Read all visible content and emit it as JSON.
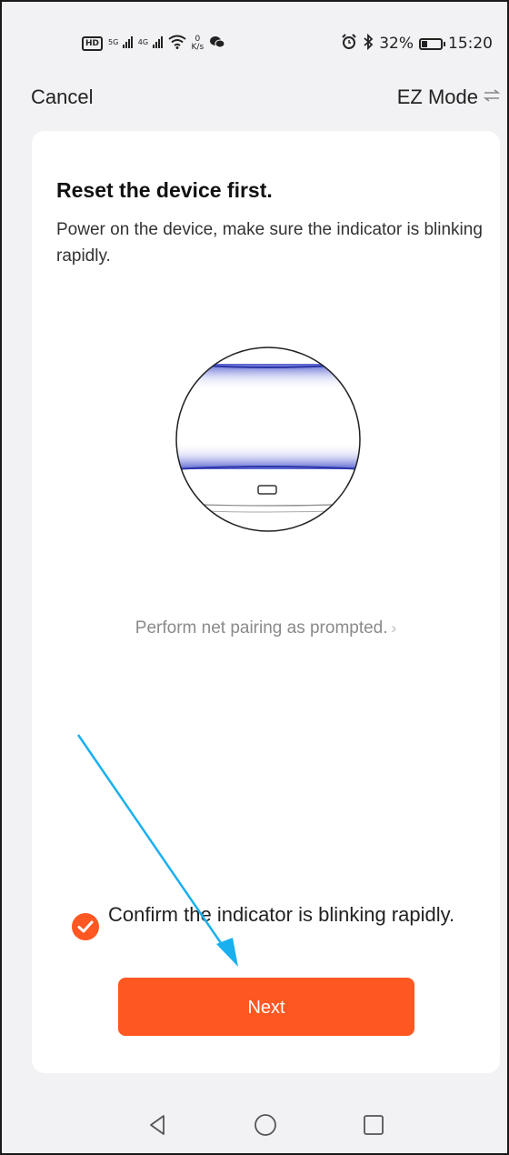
{
  "status_bar": {
    "left_icons": [
      "hd-icon",
      "signal-5g-icon",
      "signal-4g-icon",
      "wifi-icon",
      "netspeed-icon",
      "wechat-icon"
    ],
    "netspeed_value": "0",
    "netspeed_unit": "K/s",
    "signal_labels": [
      "5G",
      "4G"
    ],
    "hd_label": "HD",
    "battery_percent": "32%",
    "battery_level": 0.32,
    "time": "15:20",
    "right_icons": [
      "alarm-icon",
      "bluetooth-icon",
      "battery-icon"
    ]
  },
  "header": {
    "cancel_label": "Cancel",
    "mode_label": "EZ Mode",
    "mode_icon": "swap-icon"
  },
  "card": {
    "title": "Reset the device first.",
    "description": "Power on the device, make sure the indicator is blinking rapidly.",
    "illustration": "device-indicator-illustration",
    "pairing_link": "Perform net pairing as prompted.",
    "pairing_chevron": "›",
    "confirm_checked": true,
    "confirm_text": "Confirm the indicator is blinking rapidly.",
    "next_label": "Next"
  },
  "colors": {
    "accent": "#ff5722",
    "annotation_arrow": "#1ab0f0",
    "background": "#f2f2f4",
    "card": "#ffffff"
  },
  "nav_bar": {
    "buttons": [
      "back-icon",
      "home-icon",
      "recents-icon"
    ]
  }
}
